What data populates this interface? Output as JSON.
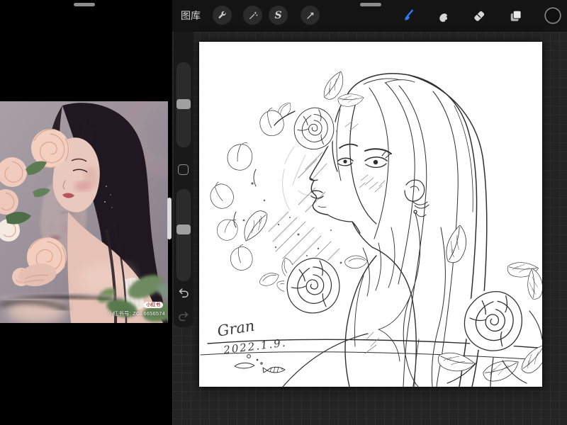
{
  "left_app": {
    "watermark_badge": "小红书",
    "watermark_id": "小红书号: ZGL6656574"
  },
  "toolbar": {
    "gallery_label": "图库",
    "selection_glyph": "S",
    "left_tools": [
      "actions",
      "adjustments",
      "selection",
      "transform"
    ],
    "right_tools": [
      "paint",
      "smudge",
      "erase",
      "layers",
      "color"
    ],
    "active_tool": "paint",
    "accent_color": "#2e7bf6"
  },
  "sidebar": {
    "sliders": [
      "brush-size",
      "brush-opacity"
    ],
    "buttons": [
      "modify",
      "undo",
      "redo"
    ]
  },
  "canvas": {
    "signature_name": "Gran",
    "signature_date": "2022.1.9.",
    "background": "#ffffff",
    "ink_color": "#2f2f2f"
  },
  "colors": {
    "left_pane_bg": "#000000",
    "toolbar_bg": "#141414",
    "workspace_bg": "#242424",
    "sidebar_bg": "#191919",
    "accent_blue": "#2e7bf6"
  }
}
